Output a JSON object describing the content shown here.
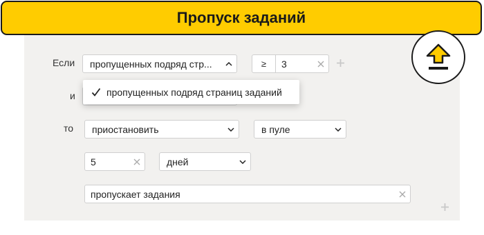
{
  "header": {
    "title": "Пропуск заданий"
  },
  "condition": {
    "if_label": "Если",
    "metric_select": "пропущенных подряд стр...",
    "operator": "≥",
    "threshold_value": "3"
  },
  "dropdown": {
    "option": "пропущенных подряд страниц заданий"
  },
  "and_label": "и",
  "action": {
    "then_label": "то",
    "action_select": "приостановить",
    "scope_select": "в пуле"
  },
  "duration": {
    "value": "5",
    "unit_select": "дней"
  },
  "reason": {
    "value": "пропускает задания"
  },
  "icons": {
    "upload": "upload-icon",
    "add": "plus-icon",
    "clear": "close-icon",
    "dropdown": "chevron-down-icon",
    "check": "check-icon"
  },
  "colors": {
    "header_bg": "#ffcc00",
    "panel_bg": "#f2f1ef",
    "badge_arrow": "#ffcc00"
  }
}
